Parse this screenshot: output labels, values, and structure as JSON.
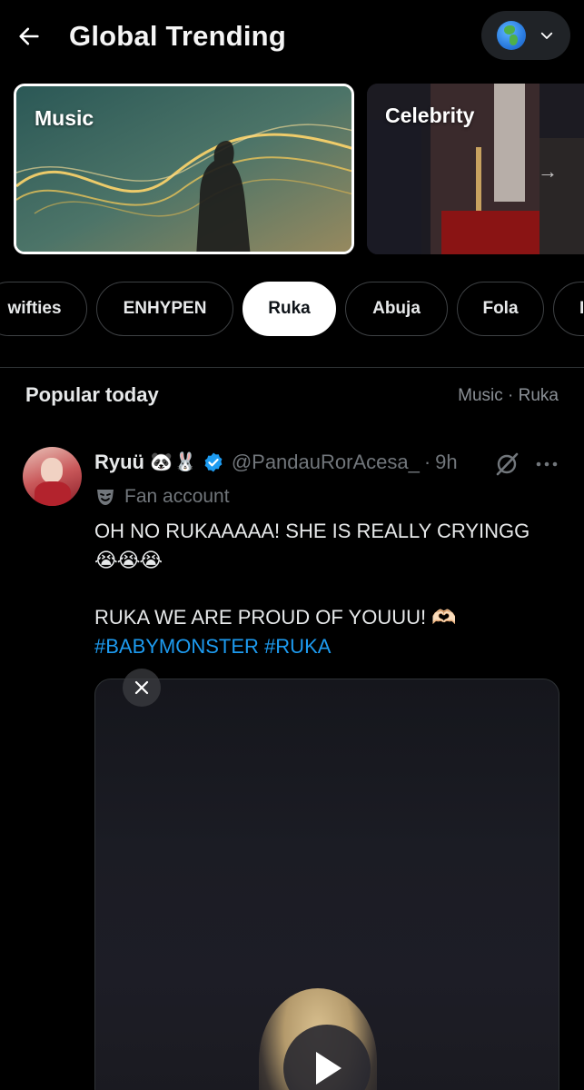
{
  "header": {
    "title": "Global Trending",
    "back_icon": "arrow-left-icon",
    "region_icon": "globe-africa-icon",
    "dropdown_icon": "chevron-down-icon"
  },
  "category_cards": [
    {
      "label": "Music",
      "selected": true
    },
    {
      "label": "Celebrity",
      "selected": false
    }
  ],
  "topic_chips": [
    {
      "label": "wifties",
      "active": false
    },
    {
      "label": "ENHYPEN",
      "active": false
    },
    {
      "label": "Ruka",
      "active": true
    },
    {
      "label": "Abuja",
      "active": false
    },
    {
      "label": "Fola",
      "active": false
    },
    {
      "label": "I",
      "active": false
    }
  ],
  "section": {
    "title": "Popular today",
    "crumbs": "Music · Ruka"
  },
  "post": {
    "display_name": "Ryuü",
    "name_emojis": [
      "🐼",
      "🐰"
    ],
    "handle": "@PandauRorAcesa_",
    "separator": "·",
    "time": "9h",
    "label": "Fan account",
    "line1": "OH NO RUKAAAAA! SHE IS REALLY CRYINGG",
    "line2_emojis": "😭😭😭",
    "line3": "RUKA WE ARE PROUD OF YOUUU! 🫶🏻",
    "hashtags": [
      "#BABYMONSTER",
      "#RUKA"
    ]
  },
  "colors": {
    "background": "#000000",
    "text_primary": "#e7e9ea",
    "text_secondary": "#71767b",
    "link": "#1d9bf0",
    "verified": "#1d9bf0",
    "chip_border": "#3e4144"
  }
}
